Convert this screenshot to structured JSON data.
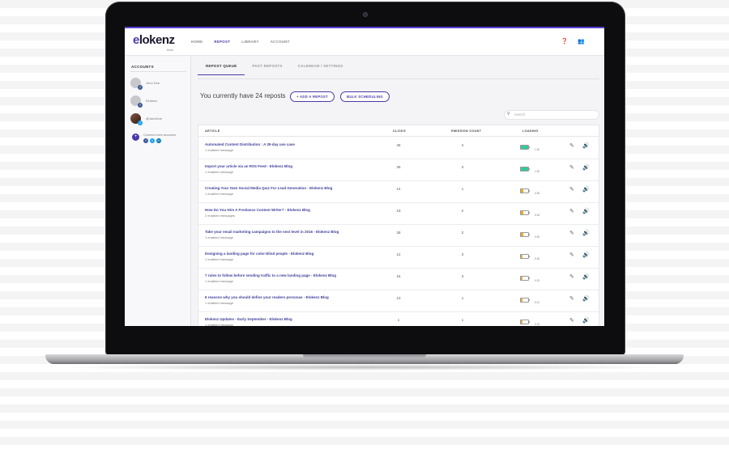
{
  "app": {
    "logo_text": "lokenz",
    "logo_letter": "e",
    "logo_sub": "beta",
    "nav": [
      {
        "label": "HOME",
        "active": false
      },
      {
        "label": "REPOST",
        "active": true
      },
      {
        "label": "LIBRARY",
        "active": false
      },
      {
        "label": "ACCOUNT",
        "active": false
      }
    ],
    "icons": {
      "help": "help-icon",
      "users": "users-icon"
    },
    "accent": "#4a3aa8"
  },
  "sidebar": {
    "title": "ACCOUNTS",
    "accounts": [
      {
        "name": "Jenn Doe",
        "network": "facebook"
      },
      {
        "name": "Elokenz",
        "network": "facebook"
      },
      {
        "name": "@JaneDoe",
        "network": "twitter"
      }
    ],
    "connect_text": "Connect more accounts"
  },
  "tabs": [
    {
      "label": "REPOST QUEUE",
      "active": true
    },
    {
      "label": "PAST REPOSTS",
      "active": false
    },
    {
      "label": "CALENDAR / SETTINGS",
      "active": false
    }
  ],
  "toolbar": {
    "repost_count_text": "You currently have 24 reposts",
    "add_label": "+ ADD A REPOST",
    "bulk_label": "BULK SCHEDULING",
    "search_placeholder": "Search"
  },
  "table": {
    "headers": {
      "article": "ARTICLE",
      "clicks": "CLICKS",
      "emission": "EMISSION COUNT",
      "loading": "LOADING"
    },
    "rows": [
      {
        "title": "Automated Content Distribution : A 30-day use case",
        "sub": "1 enabled message",
        "clicks": "45",
        "count": "4",
        "loading": "1.00",
        "level": 1.0,
        "color": "#2ecc9a"
      },
      {
        "title": "Import your article via an RSS Feed - Elokenz Blog",
        "sub": "1 enabled message",
        "clicks": "36",
        "count": "3",
        "loading": "1.00",
        "level": 1.0,
        "color": "#2ecc9a"
      },
      {
        "title": "Creating Your Own Social Media Quiz For Lead Generation - Elokenz Blog",
        "sub": "1 enabled message",
        "clicks": "14",
        "count": "1",
        "loading": "0.35",
        "level": 0.35,
        "color": "#f5a623"
      },
      {
        "title": "How Do You Hire A Freelance Content Writer? - Elokenz Blog",
        "sub": "2 enabled messages",
        "clicks": "19",
        "count": "2",
        "loading": "0.34",
        "level": 0.34,
        "color": "#f5a623"
      },
      {
        "title": "Take your email marketing campaigns to the next level in 2016 - Elokenz Blog",
        "sub": "1 enabled message",
        "clicks": "28",
        "count": "2",
        "loading": "0.29",
        "level": 0.29,
        "color": "#f5a623"
      },
      {
        "title": "Designing a landing page for color-blind people - Elokenz Blog",
        "sub": "1 enabled message",
        "clicks": "12",
        "count": "3",
        "loading": "0.25",
        "level": 0.25,
        "color": "#f5a623"
      },
      {
        "title": "7 rules to follow before sending traffic to a new landing page - Elokenz Blog",
        "sub": "1 enabled message",
        "clicks": "16",
        "count": "3",
        "loading": "0.23",
        "level": 0.23,
        "color": "#f5a623"
      },
      {
        "title": "6 reasons why you should define your readers personas - Elokenz Blog",
        "sub": "1 enabled message",
        "clicks": "13",
        "count": "1",
        "loading": "0.21",
        "level": 0.21,
        "color": "#f5a623"
      },
      {
        "title": "Elokenz Updates - Early September - Elokenz Blog",
        "sub": "1 enabled message",
        "clicks": "1",
        "count": "1",
        "loading": "0.13",
        "level": 0.13,
        "color": "#f5a623"
      }
    ]
  }
}
